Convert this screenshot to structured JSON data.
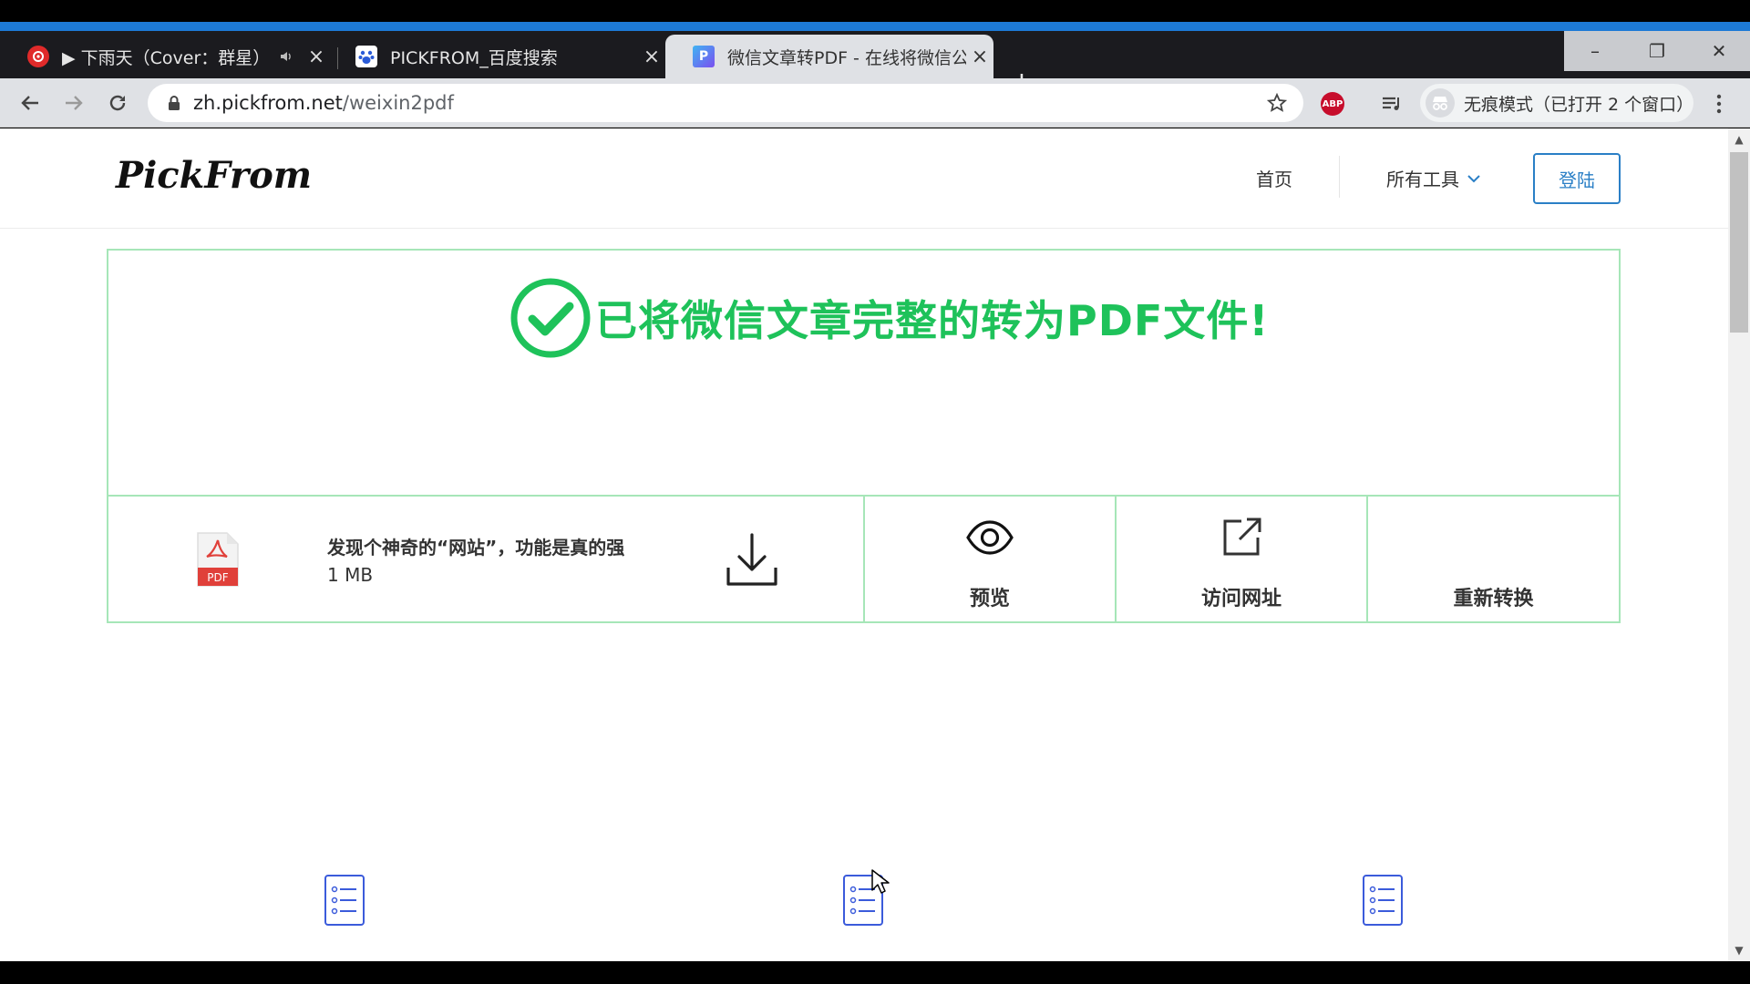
{
  "browser": {
    "tabs": [
      {
        "title": "▶ 下雨天（Cover：群星）",
        "favicon": "netease-music-icon",
        "has_audio": true
      },
      {
        "title": "PICKFROM_百度搜索",
        "favicon": "baidu-paw-icon"
      },
      {
        "title": "微信文章转PDF - 在线将微信公众号",
        "favicon": "pickfrom-icon",
        "active": true
      }
    ],
    "new_tab_label": "+",
    "url_host": "zh.pickfrom.net",
    "url_path": "/weixin2pdf",
    "incognito_label": "无痕模式（已打开 2 个窗口）",
    "window_buttons": {
      "minimize": "–",
      "restore": "❐",
      "close": "✕"
    },
    "abp_label": "ABP"
  },
  "site": {
    "logo": "PickFrom",
    "nav": {
      "home": "首页",
      "tools": "所有工具",
      "login": "登陆"
    }
  },
  "result": {
    "success_message": "已将微信文章完整的转为PDF文件!",
    "file": {
      "type_label": "PDF",
      "name": "发现个神奇的“网站”，功能是真的强",
      "size": "1 MB"
    },
    "actions": [
      {
        "label": "预览",
        "icon": "eye-icon"
      },
      {
        "label": "访问网址",
        "icon": "external-link-icon"
      },
      {
        "label": "重新转换",
        "icon": ""
      }
    ]
  },
  "colors": {
    "success_green": "#1ec25a",
    "border_green": "#a6e6b8",
    "login_blue": "#2a7fc6",
    "feature_icon_blue": "#3b5bdb",
    "pdf_red": "#e0403a"
  }
}
